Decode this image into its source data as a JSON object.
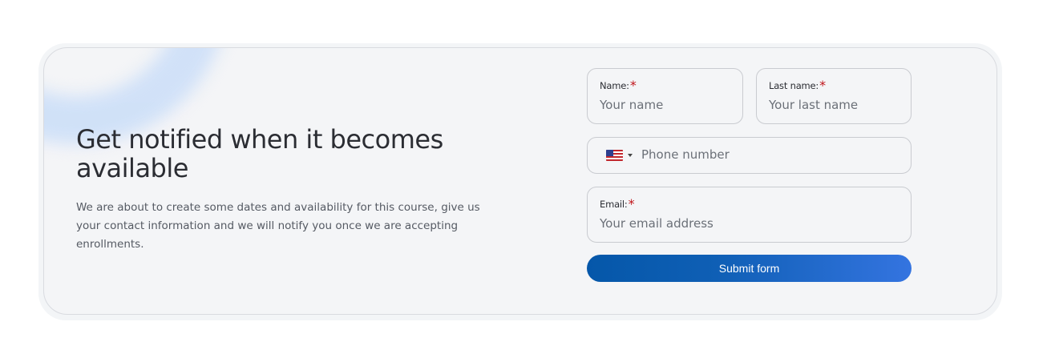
{
  "hero": {
    "title": "Get notified when it becomes available",
    "description": "We are about to create some dates and availability for this course, give us your contact information and we will notify you once we are accepting enrollments."
  },
  "form": {
    "first_name": {
      "label": "Name:",
      "required_mark": "*",
      "placeholder": "Your name",
      "value": ""
    },
    "last_name": {
      "label": "Last name:",
      "required_mark": "*",
      "placeholder": "Your last name",
      "value": ""
    },
    "phone": {
      "country_flag": "us-flag-icon",
      "placeholder": "Phone number",
      "value": ""
    },
    "email": {
      "label": "Email:",
      "required_mark": "*",
      "placeholder": "Your email address",
      "value": ""
    },
    "submit_label": "Submit form"
  },
  "colors": {
    "accent_start": "#0557a9",
    "accent_end": "#3474e0",
    "required": "#c0141a",
    "card_bg": "#f4f5f7"
  }
}
